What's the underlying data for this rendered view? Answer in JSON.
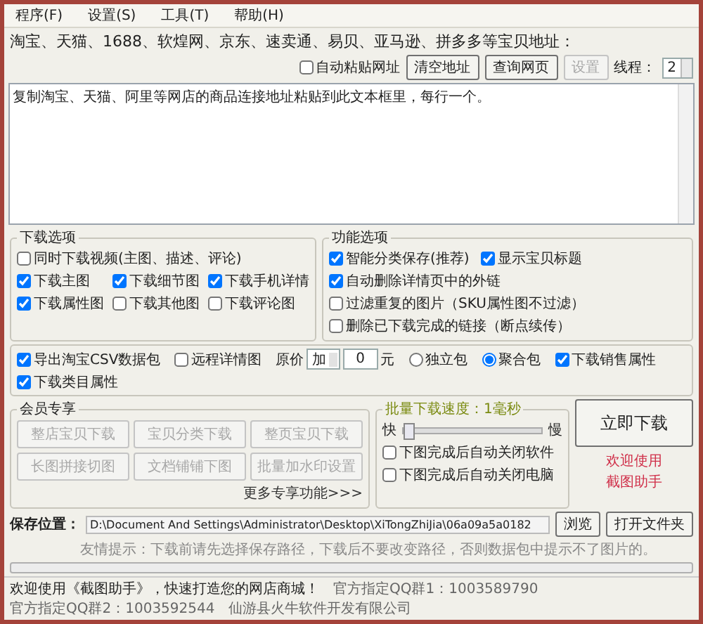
{
  "menu": [
    {
      "label": "程序(F)"
    },
    {
      "label": "设置(S)"
    },
    {
      "label": "工具(T)"
    },
    {
      "label": "帮助(H)"
    }
  ],
  "address_bar": {
    "label": "淘宝、天猫、1688、软煌网、京东、速卖通、易贝、亚马逊、拼多多等宝贝地址：",
    "auto_paste": {
      "label": "自动粘贴网址",
      "checked": false
    },
    "buttons": [
      {
        "label": "清空地址",
        "disabled": false
      },
      {
        "label": "查询网页",
        "disabled": false
      },
      {
        "label": "设置",
        "disabled": true
      }
    ],
    "threads": {
      "label": "线程：",
      "value": "2"
    }
  },
  "url_box": {
    "value": "复制淘宝、天猫、阿里等网店的商品连接地址粘贴到此文本框里，每行一个。"
  },
  "download_options": {
    "title": "下载选项",
    "video": {
      "label": "同时下载视频(主图、描述、评论)",
      "checked": false
    },
    "items": [
      {
        "label": "下载主图",
        "checked": true
      },
      {
        "label": "下载细节图",
        "checked": true
      },
      {
        "label": "下载手机详情",
        "checked": true
      },
      {
        "label": "下载属性图",
        "checked": true
      },
      {
        "label": "下载其他图",
        "checked": false
      },
      {
        "label": "下载评论图",
        "checked": false
      }
    ]
  },
  "function_options": {
    "title": "功能选项",
    "items": [
      {
        "label": "智能分类保存(推荐)",
        "checked": true
      },
      {
        "label": "显示宝贝标题",
        "checked": true
      },
      {
        "label": "自动删除详情页中的外链",
        "checked": true
      },
      {
        "label": "过滤重复的图片（SKU属性图不过滤）",
        "checked": false
      },
      {
        "label": "删除已下载完成的链接（断点续传）",
        "checked": false
      }
    ]
  },
  "export_options": {
    "csv": {
      "label": "导出淘宝CSV数据包",
      "checked": true
    },
    "remote_detail": {
      "label": "远程详情图",
      "checked": false
    },
    "price": {
      "label": "原价",
      "operator": "加",
      "value": "0",
      "unit": "元"
    },
    "packages": [
      {
        "label": "独立包",
        "selected": false
      },
      {
        "label": "聚合包",
        "selected": true
      }
    ],
    "attributes": [
      {
        "label": "下载销售属性",
        "checked": true
      },
      {
        "label": "下载类目属性",
        "checked": true
      }
    ]
  },
  "member": {
    "title": "会员专享",
    "buttons": [
      {
        "label": "整店宝贝下载",
        "disabled": true
      },
      {
        "label": "宝贝分类下载",
        "disabled": true
      },
      {
        "label": "整页宝贝下载",
        "disabled": true
      },
      {
        "label": "长图拼接切图",
        "disabled": true
      },
      {
        "label": "文档铺铺下图",
        "disabled": true
      },
      {
        "label": "批量加水印设置",
        "disabled": true
      }
    ],
    "more_link": "更多专享功能>>>"
  },
  "speed": {
    "title": "批量下载速度：1毫秒",
    "fast": "快",
    "slow": "慢",
    "level": 0,
    "options": [
      {
        "label": "下图完成后自动关闭软件",
        "checked": false
      },
      {
        "label": "下图完成后自动关闭电脑",
        "checked": false
      }
    ]
  },
  "download_button": {
    "label": "立即下载"
  },
  "welcome_links": [
    "欢迎使用",
    "截图助手"
  ],
  "save": {
    "label": "保存位置：",
    "path": "D:\\Document And Settings\\Administrator\\Desktop\\XiTongZhiJia\\06a09a5a0182",
    "buttons": [
      {
        "label": "浏览"
      },
      {
        "label": "打开文件夹"
      }
    ],
    "hint": "友情提示：下载前请先选择保存路径，下载后不要改变路径，否则数据包中提示不了图片的。"
  },
  "progress": {
    "level": 0
  },
  "status_bar": [
    "欢迎使用《截图助手》，快速打造您的网店商城！",
    "官方指定QQ群1：1003589790",
    "官方指定QQ群2：1003592544",
    "仙游县火牛软件开发有限公司"
  ]
}
